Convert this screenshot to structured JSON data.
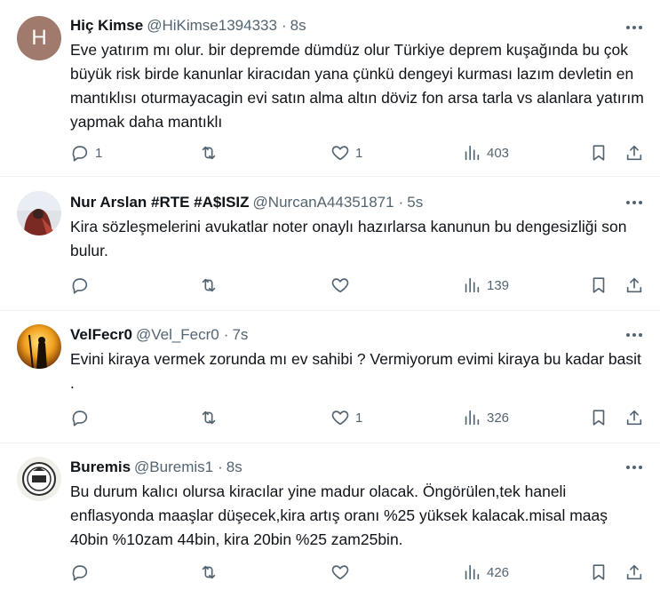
{
  "tweets": [
    {
      "avatar_letter": "H",
      "name": "Hiç Kimse",
      "handle": "@HiKimse1394333",
      "separator": "·",
      "time": "8s",
      "text": "Eve yatırım mı olur. bir depremde dümdüz olur Türkiye deprem kuşağında bu çok büyük risk birde kanunlar kiracıdan yana çünkü dengeyi kurması lazım devletin en mantıklısı oturmayacagin evi satın alma altın döviz fon arsa tarla vs alanlara yatırım yapmak daha mantıklı",
      "replies": "1",
      "retweets": "",
      "likes": "1",
      "views": "403"
    },
    {
      "avatar_letter": "",
      "name": "Nur Arslan #RTE #A$ISIZ",
      "handle": "@NurcanA44351871",
      "separator": "·",
      "time": "5s",
      "text": "Kira sözleşmelerini  avukatlar noter onaylı hazırlarsa kanunun bu dengesizliği son bulur.",
      "replies": "",
      "retweets": "",
      "likes": "",
      "views": "139"
    },
    {
      "avatar_letter": "",
      "name": "VelFecr0",
      "handle": "@Vel_Fecr0",
      "separator": "·",
      "time": "7s",
      "text": "Evini kiraya vermek zorunda mı ev sahibi ? Vermiyorum evimi kiraya bu kadar basit .",
      "replies": "",
      "retweets": "",
      "likes": "1",
      "views": "326"
    },
    {
      "avatar_letter": "",
      "name": "Buremis",
      "handle": "@Buremis1",
      "separator": "·",
      "time": "8s",
      "text": "Bu durum kalıcı olursa kiracılar yine madur olacak. Öngörülen,tek haneli enflasyonda maaşlar düşecek,kira artış oranı %25 yüksek kalacak.misal maaş 40bin %10zam 44bin, kira 20bin %25 zam25bin.",
      "replies": "",
      "retweets": "",
      "likes": "",
      "views": "426"
    }
  ],
  "icons": {
    "more": "more-horizontal-icon",
    "reply": "reply-bubble-icon",
    "retweet": "retweet-icon",
    "like": "heart-icon",
    "views": "views-bar-chart-icon",
    "bookmark": "bookmark-icon",
    "share": "share-upload-icon"
  },
  "colors": {
    "text": "#0f1419",
    "secondary": "#536471",
    "divider": "#eff3f4",
    "avatar_h": "#a07a6c"
  }
}
